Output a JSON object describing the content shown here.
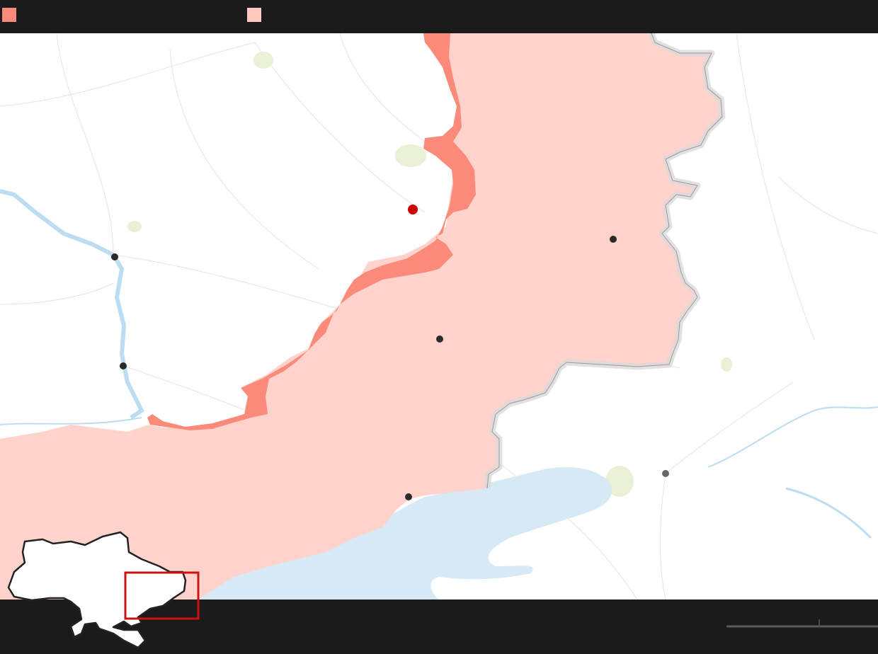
{
  "legend": {
    "items": [
      {
        "label": "",
        "color": "#fb8a7b"
      },
      {
        "label": "",
        "color": "#ffc9c0"
      }
    ]
  },
  "colors": {
    "recent_advance": "#fb8a7b",
    "occupied": "#ffd3cc",
    "water": "#d8e9f6",
    "border": "#d9d9d9",
    "city_dot": "#2b2b2b",
    "highlight_dot": "#cc0000",
    "inset_frame": "#cc1111"
  },
  "map": {
    "cities": [
      {
        "name": ""
      },
      {
        "name": ""
      },
      {
        "name": ""
      },
      {
        "name": ""
      },
      {
        "name": ""
      },
      {
        "name": ""
      },
      {
        "name": ""
      }
    ],
    "highlight_city": {
      "name": ""
    }
  },
  "scale": {
    "label": ""
  },
  "inset": {
    "country": "Ukraine"
  }
}
